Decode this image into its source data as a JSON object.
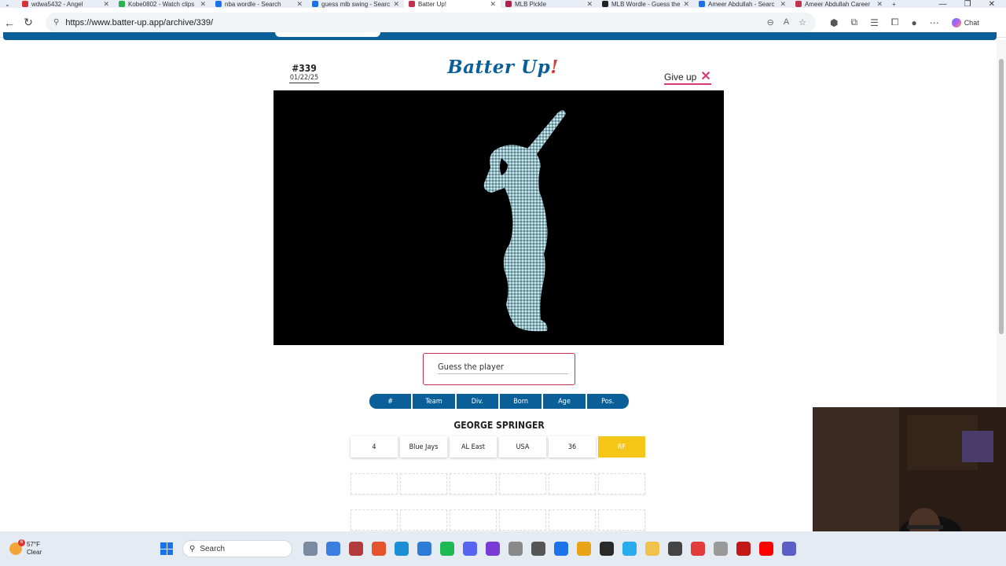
{
  "browser": {
    "tabs": [
      {
        "label": "wdwa5432 - Angel",
        "color": "#d6333a"
      },
      {
        "label": "Kobe0802 - Watch clips",
        "color": "#2bb24c"
      },
      {
        "label": "nba wordle - Search",
        "color": "#1a73e8"
      },
      {
        "label": "guess mlb swing - Searc",
        "color": "#1a73e8"
      },
      {
        "label": "Batter Up!",
        "color": "#c0334a",
        "active": true
      },
      {
        "label": "MLB Pickle",
        "color": "#b0224a"
      },
      {
        "label": "MLB Wordle - Guess the",
        "color": "#222222"
      },
      {
        "label": "Ameer Abdullah - Searc",
        "color": "#1a73e8"
      },
      {
        "label": "Ameer Abdullah Career",
        "color": "#c0334a"
      }
    ],
    "url": "https://www.batter-up.app/archive/339/",
    "chat_label": "Chat"
  },
  "game": {
    "puzzle_number": "#339",
    "puzzle_date": "01/22/25",
    "title": "Batter Up",
    "title_bang": "!",
    "give_up_label": "Give up",
    "guess_placeholder": "Guess the player",
    "columns": [
      "#",
      "Team",
      "Div.",
      "Born",
      "Age",
      "Pos."
    ],
    "guesses": [
      {
        "name": "GEORGE SPRINGER",
        "cells": [
          {
            "value": "4",
            "hit": false
          },
          {
            "value": "Blue Jays",
            "hit": false
          },
          {
            "value": "AL East",
            "hit": false
          },
          {
            "value": "USA",
            "hit": false
          },
          {
            "value": "36",
            "hit": false
          },
          {
            "value": "RF",
            "hit": true
          }
        ]
      }
    ],
    "hit_color": "#f5c518",
    "accent_color": "#0b5f99"
  },
  "taskbar": {
    "temperature": "57°F",
    "condition": "Clear",
    "badge": "6",
    "search_label": "Search"
  }
}
